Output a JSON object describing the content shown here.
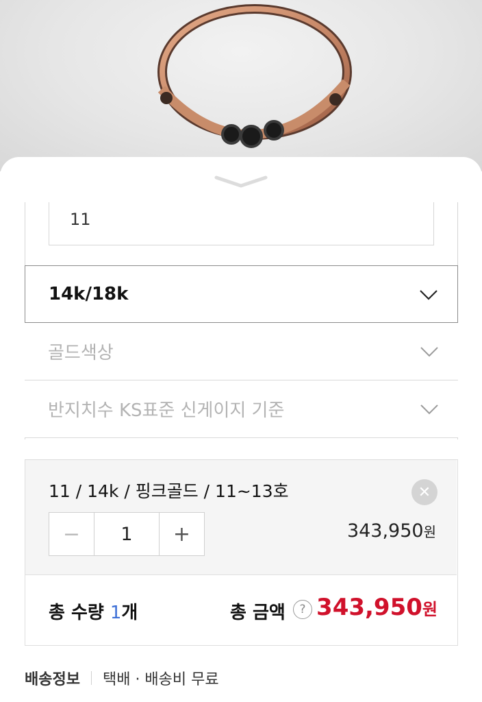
{
  "option_input": {
    "value": "11"
  },
  "selects": {
    "metal": "14k/18k",
    "gold_color_placeholder": "골드색상",
    "ring_size_placeholder": "반지치수 KS표준 신게이지 기준"
  },
  "selected_item": {
    "title": "11 / 14k / 핑크골드 / 11~13호",
    "remove_icon": "close-icon",
    "minus": "−",
    "quantity": "1",
    "plus": "+",
    "price": "343,950",
    "currency": "원"
  },
  "totals": {
    "qty_label_prefix": "총 수량 ",
    "qty_value": "1",
    "qty_unit": "개",
    "amount_label": "총 금액",
    "help": "?",
    "amount": "343,950",
    "currency": "원",
    "accent_color": "#d0112b",
    "qty_color": "#3c6fd6"
  },
  "shipping": {
    "label": "배송정보",
    "value": "택배 · 배송비 무료"
  }
}
